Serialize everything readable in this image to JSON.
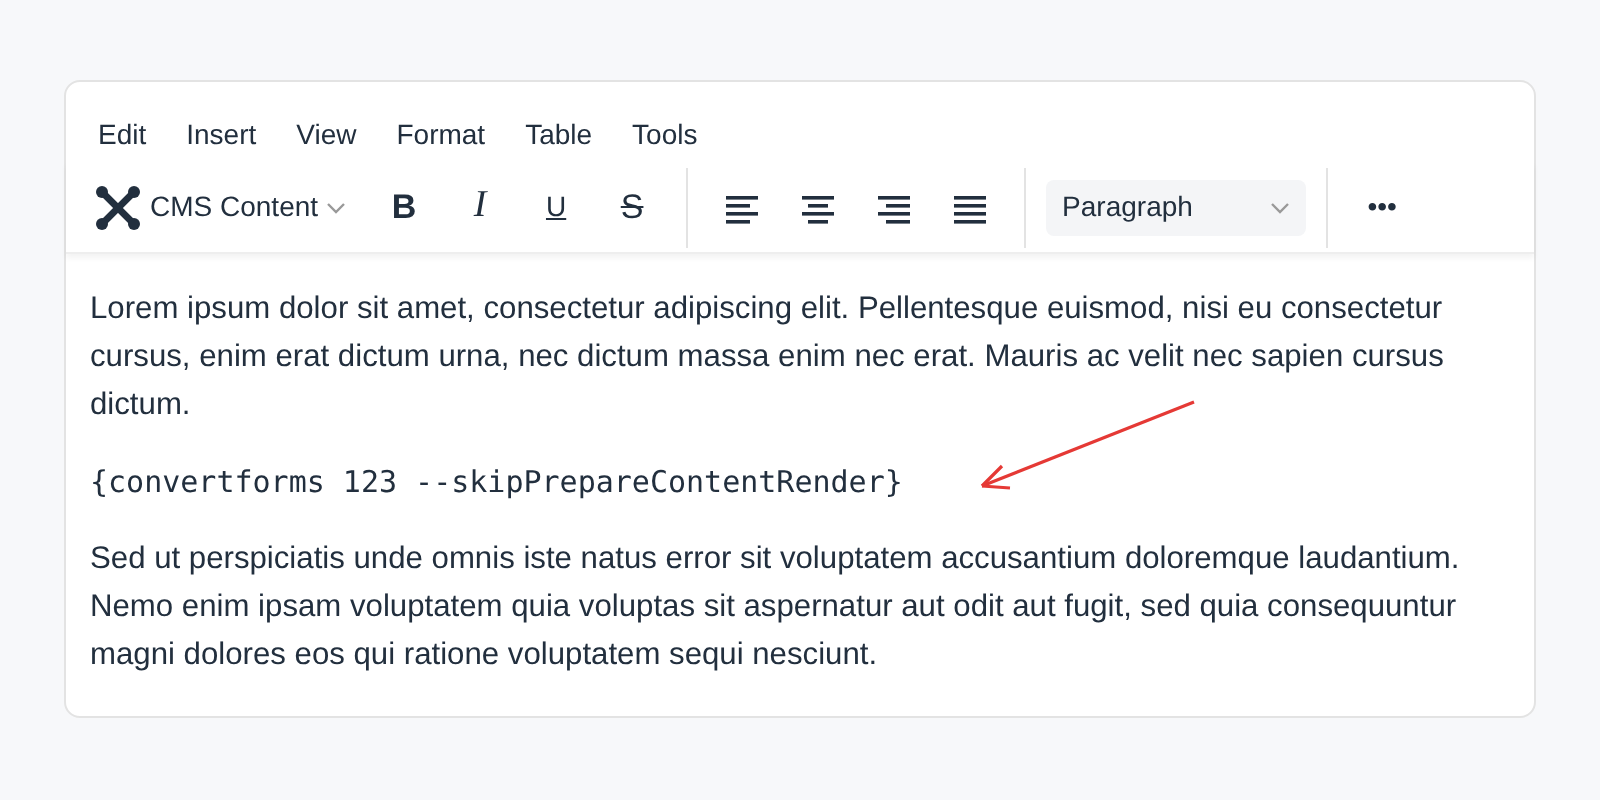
{
  "menu": [
    "Edit",
    "Insert",
    "View",
    "Format",
    "Table",
    "Tools"
  ],
  "toolbar": {
    "dropdown": "CMS Content",
    "format_buttons": [
      {
        "kind": "bold",
        "label": "B"
      },
      {
        "kind": "italic",
        "label": "I"
      },
      {
        "kind": "underline",
        "label": "U"
      },
      {
        "kind": "strike",
        "label": "S"
      }
    ],
    "align_buttons": [
      {
        "kind": "left"
      },
      {
        "kind": "center"
      },
      {
        "kind": "right"
      },
      {
        "kind": "justify"
      }
    ],
    "block_format": "Paragraph",
    "more": "•••"
  },
  "content": [
    {
      "kind": "text",
      "text": "Lorem ipsum dolor sit amet, consectetur adipiscing elit. Pellentesque euismod, nisi eu consectetur cursus, enim erat dictum urna, nec dictum massa enim nec erat. Mauris ac velit nec sapien cursus dictum."
    },
    {
      "kind": "code",
      "text": "{convertforms 123 --skipPrepareContentRender}"
    },
    {
      "kind": "text",
      "text": "Sed ut perspiciatis unde omnis iste natus error sit voluptatem accusantium doloremque laudantium. Nemo enim ipsam voluptatem quia voluptas sit aspernatur aut odit aut fugit, sed quia consequuntur magni dolores eos qui ratione voluptatem sequi nesciunt."
    }
  ]
}
